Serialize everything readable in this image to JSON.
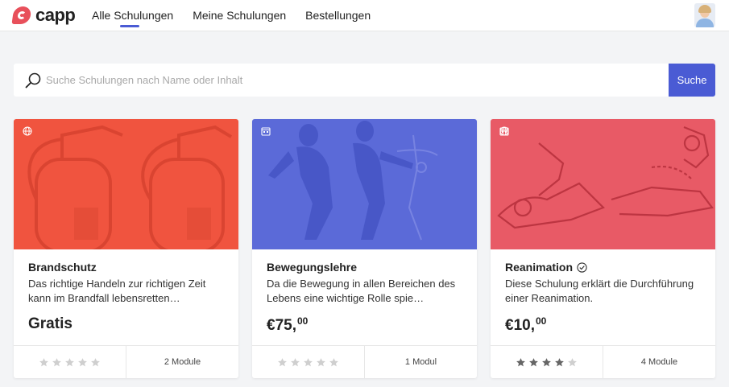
{
  "header": {
    "logo_text": "capp",
    "nav": [
      {
        "label": "Alle Schulungen",
        "active": true
      },
      {
        "label": "Meine Schulungen",
        "active": false
      },
      {
        "label": "Bestellungen",
        "active": false
      }
    ]
  },
  "search": {
    "placeholder": "Suche Schulungen nach Name oder Inhalt",
    "value": "",
    "button_label": "Suche"
  },
  "colors": {
    "accent": "#4a5bd4",
    "brand": "#e8505b",
    "card1_overlay": "#f0543f",
    "card2_overlay": "#5b6ad8",
    "card3_overlay": "#e85a66"
  },
  "cards": [
    {
      "title": "Brandschutz",
      "description": "Das richtige Handeln zur richtigen Zeit kann im Brandfall lebensretten…",
      "price_main": "Gratis",
      "price_cents": "",
      "rating": 0,
      "modules": "2 Module",
      "badges": [
        "globe-icon"
      ],
      "verified": false
    },
    {
      "title": "Bewegungslehre",
      "description": "Da die Bewegung in allen Bereichen des Lebens eine wichtige Rolle spie…",
      "price_main": "€75,",
      "price_cents": "00",
      "rating": 0,
      "modules": "1 Modul",
      "badges": [
        "calendar-icon"
      ],
      "verified": false
    },
    {
      "title": "Reanimation",
      "description": "Diese Schulung erklärt die Durchführung einer Reanimation.",
      "price_main": "€10,",
      "price_cents": "00",
      "rating": 4,
      "modules": "4 Module",
      "badges": [
        "globe-icon",
        "calendar-icon"
      ],
      "verified": true
    }
  ]
}
